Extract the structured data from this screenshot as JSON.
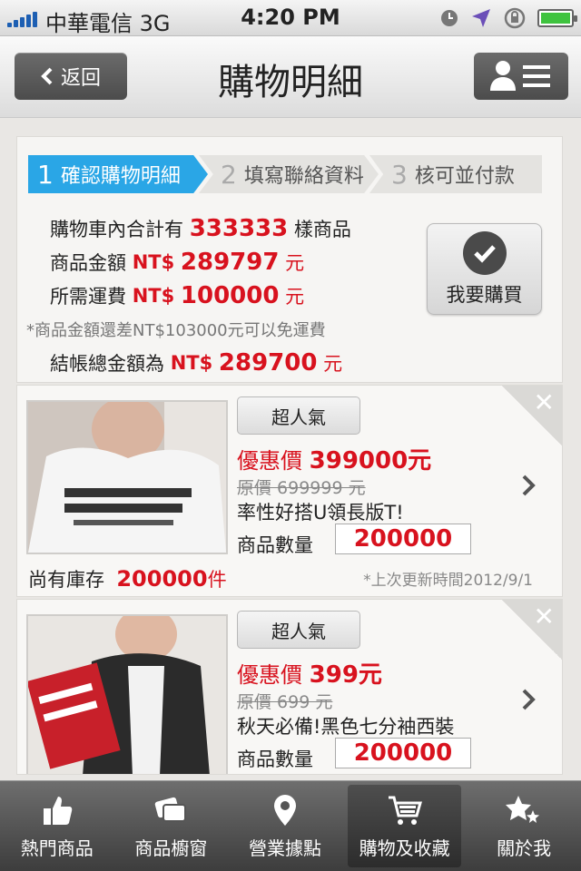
{
  "status_bar": {
    "carrier": "中華電信 3G",
    "time": "4:20 PM"
  },
  "header": {
    "back_label": "返回",
    "title": "購物明細"
  },
  "steps": [
    {
      "num": "1",
      "label": "確認購物明細"
    },
    {
      "num": "2",
      "label": "填寫聯絡資料"
    },
    {
      "num": "3",
      "label": "核可並付款"
    }
  ],
  "summary": {
    "count_prefix": "購物車內合計有",
    "count": "333333",
    "count_suffix": "樣商品",
    "goods_label": "商品金額",
    "goods_currency": "NT$",
    "goods_amount": "289797",
    "goods_unit": "元",
    "shipping_label": "所需運費",
    "shipping_currency": "NT$",
    "shipping_amount": "100000",
    "shipping_unit": "元",
    "note": "*商品金額還差NT$103000元可以免運費",
    "total_label": "結帳總金額為",
    "total_currency": "NT$",
    "total_amount": "289700",
    "total_unit": "元",
    "buy_button": "我要購買"
  },
  "items": [
    {
      "tag": "超人氣",
      "price_label": "優惠價",
      "price": "399000元",
      "original": "原價 699999 元",
      "name": "率性好搭U領長版T!",
      "qty_label": "商品數量",
      "qty": "200000",
      "stock_label": "尚有庫存",
      "stock": "200000",
      "stock_unit": "件",
      "updated": "*上次更新時間2012/9/1"
    },
    {
      "tag": "超人氣",
      "price_label": "優惠價",
      "price": "399元",
      "original": "原價 699 元",
      "name": "秋天必備!黑色七分袖西裝",
      "qty_label": "商品數量",
      "qty": "200000"
    }
  ],
  "tabbar": [
    {
      "label": "熱門商品",
      "icon": "thumbs-up-icon"
    },
    {
      "label": "商品櫥窗",
      "icon": "cards-icon"
    },
    {
      "label": "營業據點",
      "icon": "location-pin-icon"
    },
    {
      "label": "購物及收藏",
      "icon": "cart-icon"
    },
    {
      "label": "關於我",
      "icon": "stars-icon"
    }
  ],
  "colors": {
    "accent": "#2aa6e6",
    "price_red": "#d8121e"
  }
}
